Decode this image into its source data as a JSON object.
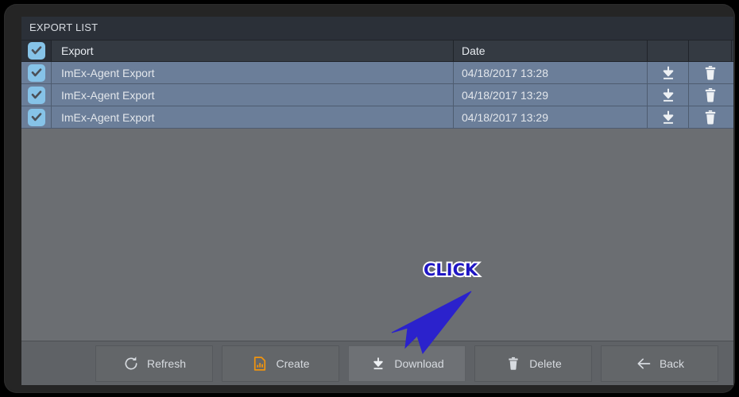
{
  "window": {
    "title": "EXPORT LIST"
  },
  "table": {
    "columns": [
      {
        "key": "check",
        "label": ""
      },
      {
        "key": "name",
        "label": "Export"
      },
      {
        "key": "date",
        "label": "Date"
      },
      {
        "key": "download",
        "label": ""
      },
      {
        "key": "delete",
        "label": ""
      }
    ],
    "header_checkbox": {
      "icon": "checkbox-checked-icon",
      "checked": true
    },
    "rows": [
      {
        "checked": true,
        "name": "ImEx-Agent Export",
        "date": "04/18/2017 13:28",
        "download_icon": "download-icon",
        "delete_icon": "trash-icon"
      },
      {
        "checked": true,
        "name": "ImEx-Agent Export",
        "date": "04/18/2017 13:29",
        "download_icon": "download-icon",
        "delete_icon": "trash-icon"
      },
      {
        "checked": true,
        "name": "ImEx-Agent Export",
        "date": "04/18/2017 13:29",
        "download_icon": "download-icon",
        "delete_icon": "trash-icon"
      }
    ]
  },
  "toolbar": {
    "buttons": [
      {
        "id": "refresh",
        "label": "Refresh",
        "icon": "refresh-icon",
        "active": false
      },
      {
        "id": "create",
        "label": "Create",
        "icon": "create-document-chart-icon",
        "active": false
      },
      {
        "id": "download",
        "label": "Download",
        "icon": "download-icon",
        "active": true
      },
      {
        "id": "delete",
        "label": "Delete",
        "icon": "trash-icon",
        "active": false
      },
      {
        "id": "back",
        "label": "Back",
        "icon": "arrow-left-icon",
        "active": false
      }
    ]
  },
  "annotation": {
    "label": "CLICK",
    "arrow_icon": "pointer-arrow-icon",
    "color": "#2017c4",
    "outline_color": "#ffffff"
  },
  "colors": {
    "titlebar_bg": "#2b3038",
    "table_header_bg": "#343a42",
    "row_bg": "#6b7e99",
    "page_bg": "#6b6e72",
    "toolbar_bg": "#5f6266",
    "checkbox_bg": "#86c3e8",
    "create_icon": "#f0940f",
    "text": "#e3e7ec"
  }
}
